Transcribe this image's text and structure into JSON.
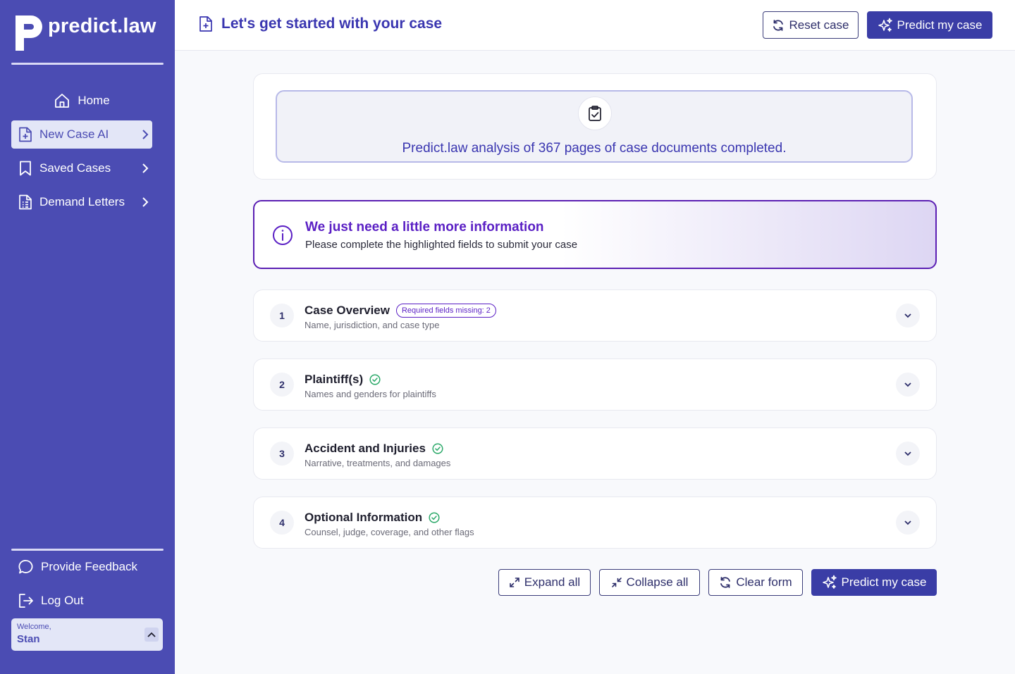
{
  "app": {
    "name": "predict.law"
  },
  "sidebar": {
    "nav": [
      {
        "label": "Home",
        "icon": "home-icon"
      },
      {
        "label": "New Case AI",
        "icon": "file-plus-icon",
        "active": true
      },
      {
        "label": "Saved Cases",
        "icon": "bookmark-icon"
      },
      {
        "label": "Demand Letters",
        "icon": "document-list-icon"
      }
    ],
    "footer": [
      {
        "label": "Provide Feedback",
        "icon": "chat-bubble-icon"
      },
      {
        "label": "Log Out",
        "icon": "logout-icon"
      }
    ],
    "user": {
      "welcome": "Welcome,",
      "name": "Stan"
    }
  },
  "header": {
    "title": "Let's get started with your case",
    "reset_label": "Reset case",
    "predict_label": "Predict my case"
  },
  "analysis": {
    "message": "Predict.law analysis of 367 pages of case documents completed."
  },
  "info": {
    "title": "We just need a little more information",
    "subtitle": "Please complete the highlighted fields to submit your case"
  },
  "sections": [
    {
      "number": "1",
      "title": "Case Overview",
      "subtitle": "Name, jurisdiction, and case type",
      "badge": "Required fields missing: 2",
      "complete": false
    },
    {
      "number": "2",
      "title": "Plaintiff(s)",
      "subtitle": "Names and genders for plaintiffs",
      "complete": true
    },
    {
      "number": "3",
      "title": "Accident and Injuries",
      "subtitle": "Narrative, treatments, and damages",
      "complete": true
    },
    {
      "number": "4",
      "title": "Optional Information",
      "subtitle": "Counsel, judge, coverage, and other flags",
      "complete": true
    }
  ],
  "actions": {
    "expand_label": "Expand all",
    "collapse_label": "Collapse all",
    "clear_label": "Clear form",
    "predict_label": "Predict my case"
  },
  "colors": {
    "sidebar": "#4b4cb3",
    "primary": "#3a3da6",
    "accent_purple": "#5a1fc4",
    "success": "#2eaa6b"
  }
}
